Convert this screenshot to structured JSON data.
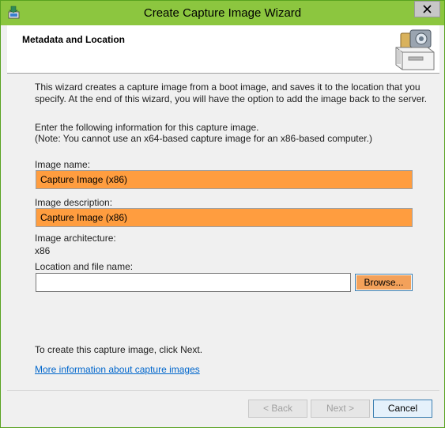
{
  "window": {
    "title": "Create Capture Image Wizard"
  },
  "header": {
    "title": "Metadata and Location"
  },
  "intro": {
    "line1": "This wizard creates a capture image from a boot image, and saves it to the location that you",
    "line2": "specify. At the end of this wizard, you will have the option to add the image back to the server."
  },
  "instructions": {
    "line1": "Enter the following information for this capture image.",
    "line2": "(Note: You cannot use an x64-based capture image for an x86-based computer.)"
  },
  "fields": {
    "image_name_label": "Image name:",
    "image_name_value": "Capture Image (x86)",
    "image_description_label": "Image description:",
    "image_description_value": "Capture Image (x86)",
    "architecture_label": "Image architecture:",
    "architecture_value": "x86",
    "location_label": "Location and file name:",
    "location_value": "",
    "browse_label": "Browse..."
  },
  "footer_text": "To create this capture image, click Next.",
  "more_info_link": "More information about capture images",
  "buttons": {
    "back": "< Back",
    "next": "Next >",
    "cancel": "Cancel"
  },
  "icons": {
    "app": "wizard-app-icon",
    "header": "capture-image-drive-icon",
    "close": "close-icon"
  },
  "colors": {
    "titlebar": "#8cc63f",
    "highlight": "#ff9d3f",
    "link": "#0066cc"
  }
}
